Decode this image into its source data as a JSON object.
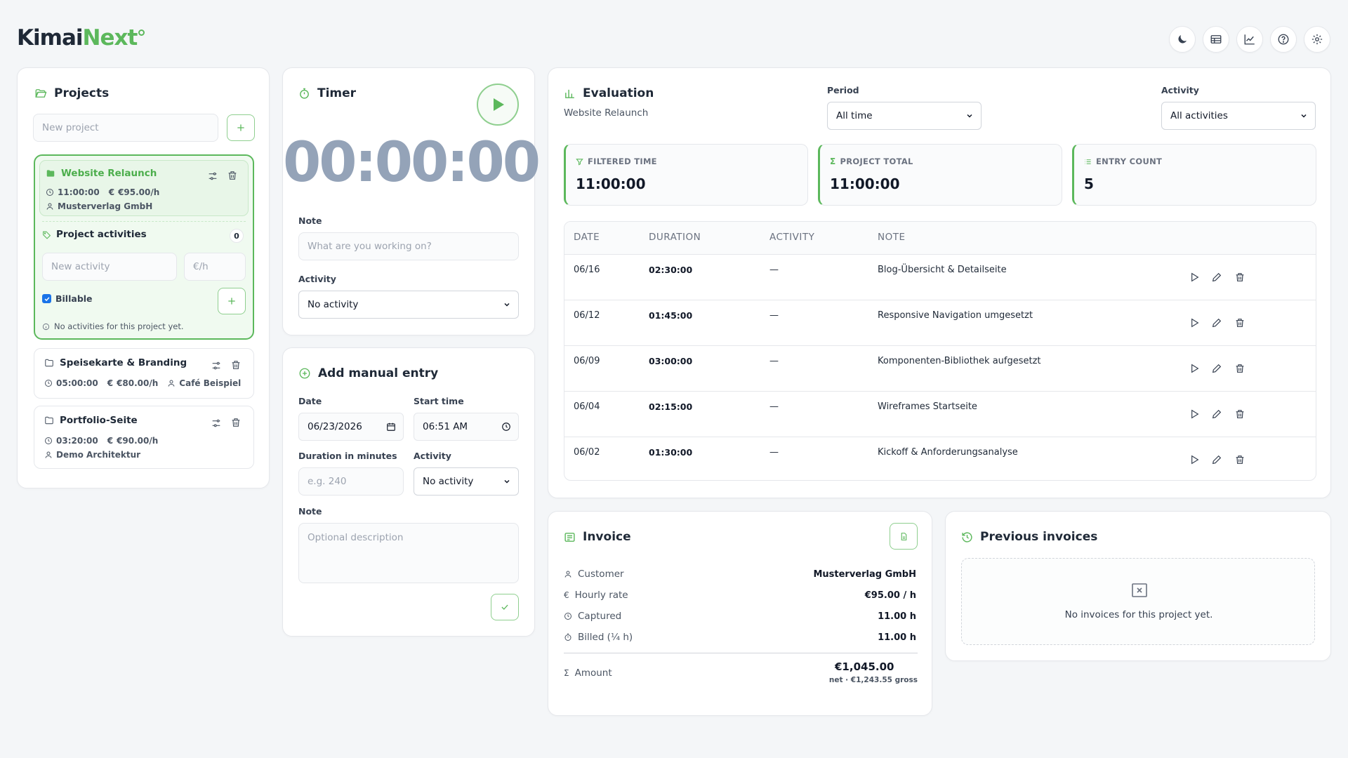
{
  "app": {
    "logo_main": "Kimai",
    "logo_accent": "Next"
  },
  "header_icons": [
    "moon-icon",
    "table-icon",
    "chart-icon",
    "help-icon",
    "settings-icon"
  ],
  "colors": {
    "accent": "#5cb85c",
    "timer": "#94a3b8"
  },
  "projects": {
    "title": "Projects",
    "new_placeholder": "New project",
    "items": [
      {
        "name": "Website Relaunch",
        "time": "11:00:00",
        "rate": "€95.00/h",
        "customer": "Musterverlag GmbH"
      },
      {
        "name": "Speisekarte & Branding",
        "time": "05:00:00",
        "rate": "€80.00/h",
        "customer": "Café Beispiel"
      },
      {
        "name": "Portfolio-Seite",
        "time": "03:20:00",
        "rate": "€90.00/h",
        "customer": "Demo Architektur"
      }
    ],
    "activities": {
      "title": "Project activities",
      "count": "0",
      "new_placeholder": "New activity",
      "rate_placeholder": "€/h",
      "billable_label": "Billable",
      "billable_checked": true,
      "empty": "No activities for this project yet."
    }
  },
  "timer": {
    "title": "Timer",
    "display": "00:00:00",
    "note_label": "Note",
    "note_placeholder": "What are you working on?",
    "activity_label": "Activity",
    "activity_value": "No activity"
  },
  "manual": {
    "title": "Add manual entry",
    "date_label": "Date",
    "date_value": "06/23/2026",
    "start_label": "Start time",
    "start_value": "06:51 AM",
    "duration_label": "Duration in minutes",
    "duration_placeholder": "e.g. 240",
    "activity_label": "Activity",
    "activity_value": "No activity",
    "note_label": "Note",
    "note_placeholder": "Optional description"
  },
  "evaluation": {
    "title": "Evaluation",
    "subtitle": "Website Relaunch",
    "period_label": "Period",
    "period_value": "All time",
    "activity_label": "Activity",
    "activity_value": "All activities",
    "stats": [
      {
        "label": "FILTERED TIME",
        "value": "11:00:00"
      },
      {
        "label": "PROJECT TOTAL",
        "value": "11:00:00"
      },
      {
        "label": "ENTRY COUNT",
        "value": "5"
      }
    ],
    "columns": [
      "DATE",
      "DURATION",
      "ACTIVITY",
      "NOTE"
    ],
    "rows": [
      {
        "date": "06/16",
        "duration": "02:30:00",
        "activity": "—",
        "note": "Blog-Übersicht & Detailseite"
      },
      {
        "date": "06/12",
        "duration": "01:45:00",
        "activity": "—",
        "note": "Responsive Navigation umgesetzt"
      },
      {
        "date": "06/09",
        "duration": "03:00:00",
        "activity": "—",
        "note": "Komponenten-Bibliothek aufgesetzt"
      },
      {
        "date": "06/04",
        "duration": "02:15:00",
        "activity": "—",
        "note": "Wireframes Startseite"
      },
      {
        "date": "06/02",
        "duration": "01:30:00",
        "activity": "—",
        "note": "Kickoff & Anforderungsanalyse"
      }
    ]
  },
  "invoice": {
    "title": "Invoice",
    "customer_label": "Customer",
    "customer_value": "Musterverlag GmbH",
    "rate_label": "Hourly rate",
    "rate_value": "€95.00 / h",
    "captured_label": "Captured",
    "captured_value": "11.00 h",
    "billed_label": "Billed (¼ h)",
    "billed_value": "11.00 h",
    "amount_label": "Amount",
    "amount_value": "€1,045.00",
    "amount_sub": "net · €1,243.55 gross"
  },
  "previous": {
    "title": "Previous invoices",
    "empty": "No invoices for this project yet."
  }
}
